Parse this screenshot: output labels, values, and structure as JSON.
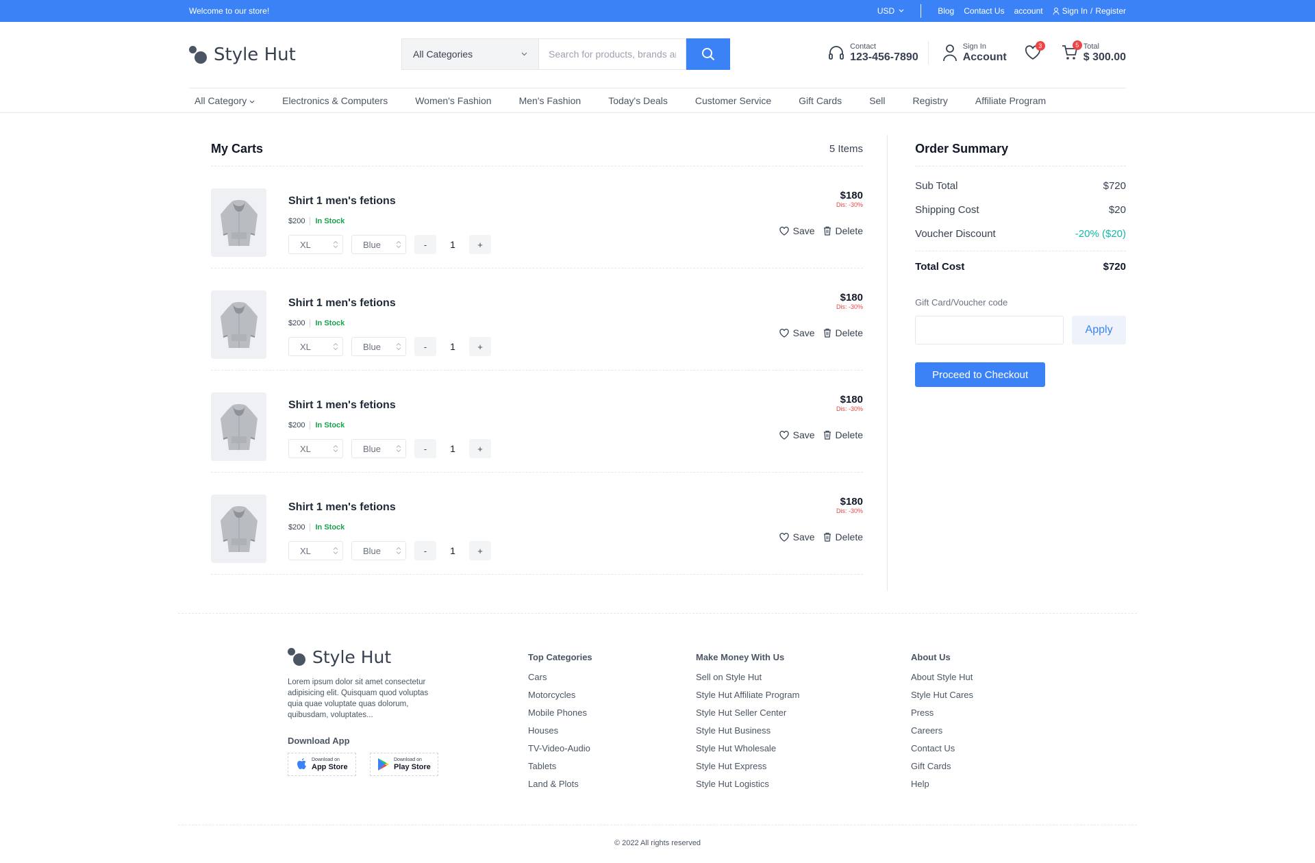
{
  "topbar": {
    "welcome": "Welcome to our store!",
    "currency": "USD",
    "links": [
      "Blog",
      "Contact Us",
      "account"
    ],
    "signin": "Sign In",
    "register": "Register"
  },
  "header": {
    "brand": "Style Hut",
    "category_select": "All Categories",
    "search_placeholder": "Search for products, brands and more",
    "contact_label": "Contact",
    "contact_phone": "123-456-7890",
    "signin_label": "Sign In",
    "account_label": "Account",
    "wishlist_count": "3",
    "cart_count": "5",
    "total_label": "Total",
    "total_value": "$ 300.00"
  },
  "nav": {
    "items": [
      "All Category",
      "Electronics & Computers",
      "Women's Fashion",
      "Men's Fashion",
      "Today's Deals",
      "Customer Service",
      "Gift Cards",
      "Sell",
      "Registry",
      "Affiliate Program"
    ]
  },
  "cart": {
    "title": "My Carts",
    "count": "5 Items",
    "items": [
      {
        "name": "Shirt 1 men's fetions",
        "list_price": "$200",
        "stock": "In Stock",
        "size": "XL",
        "color": "Blue",
        "qty": "1",
        "price": "$180",
        "discount": "Dis: -30%"
      },
      {
        "name": "Shirt 1 men's fetions",
        "list_price": "$200",
        "stock": "In Stock",
        "size": "XL",
        "color": "Blue",
        "qty": "1",
        "price": "$180",
        "discount": "Dis: -30%"
      },
      {
        "name": "Shirt 1 men's fetions",
        "list_price": "$200",
        "stock": "In Stock",
        "size": "XL",
        "color": "Blue",
        "qty": "1",
        "price": "$180",
        "discount": "Dis: -30%"
      },
      {
        "name": "Shirt 1 men's fetions",
        "list_price": "$200",
        "stock": "In Stock",
        "size": "XL",
        "color": "Blue",
        "qty": "1",
        "price": "$180",
        "discount": "Dis: -30%"
      }
    ],
    "minus": "-",
    "plus": "+",
    "save_label": "Save",
    "delete_label": "Delete"
  },
  "summary": {
    "title": "Order Summary",
    "subtotal_label": "Sub Total",
    "subtotal_value": "$720",
    "shipping_label": "Shipping Cost",
    "shipping_value": "$20",
    "voucher_label": "Voucher Discount",
    "voucher_value": "-20% ($20)",
    "total_label": "Total Cost",
    "total_value": "$720",
    "gift_label": "Gift Card/Voucher code",
    "apply_label": "Apply",
    "checkout_label": "Proceed to Checkout"
  },
  "footer": {
    "brand": "Style Hut",
    "description": "Lorem ipsum dolor sit amet consectetur adipisicing elit. Quisquam quod voluptas quia quae voluptate quas dolorum, quibusdam, voluptates...",
    "download_title": "Download App",
    "app_store_small": "Download on",
    "app_store": "App Store",
    "play_store_small": "Download on",
    "play_store": "Play Store",
    "columns": [
      {
        "title": "Top Categories",
        "links": [
          "Cars",
          "Motorcycles",
          "Mobile Phones",
          "Houses",
          "TV-Video-Audio",
          "Tablets",
          "Land & Plots"
        ]
      },
      {
        "title": "Make Money With Us",
        "links": [
          "Sell on Style Hut",
          "Style Hut Affiliate Program",
          "Style Hut Seller Center",
          "Style Hut Business",
          "Style Hut Wholesale",
          "Style Hut Express",
          "Style Hut Logistics"
        ]
      },
      {
        "title": "About Us",
        "links": [
          "About Style Hut",
          "Style Hut Cares",
          "Press",
          "Careers",
          "Contact Us",
          "Gift Cards",
          "Help"
        ]
      }
    ],
    "copyright": "© 2022 All rights reserved"
  },
  "colors": {
    "accent": "#3b82f6",
    "in_stock": "#16a34a",
    "discount": "#ef4444",
    "voucher": "#14b8a6"
  }
}
